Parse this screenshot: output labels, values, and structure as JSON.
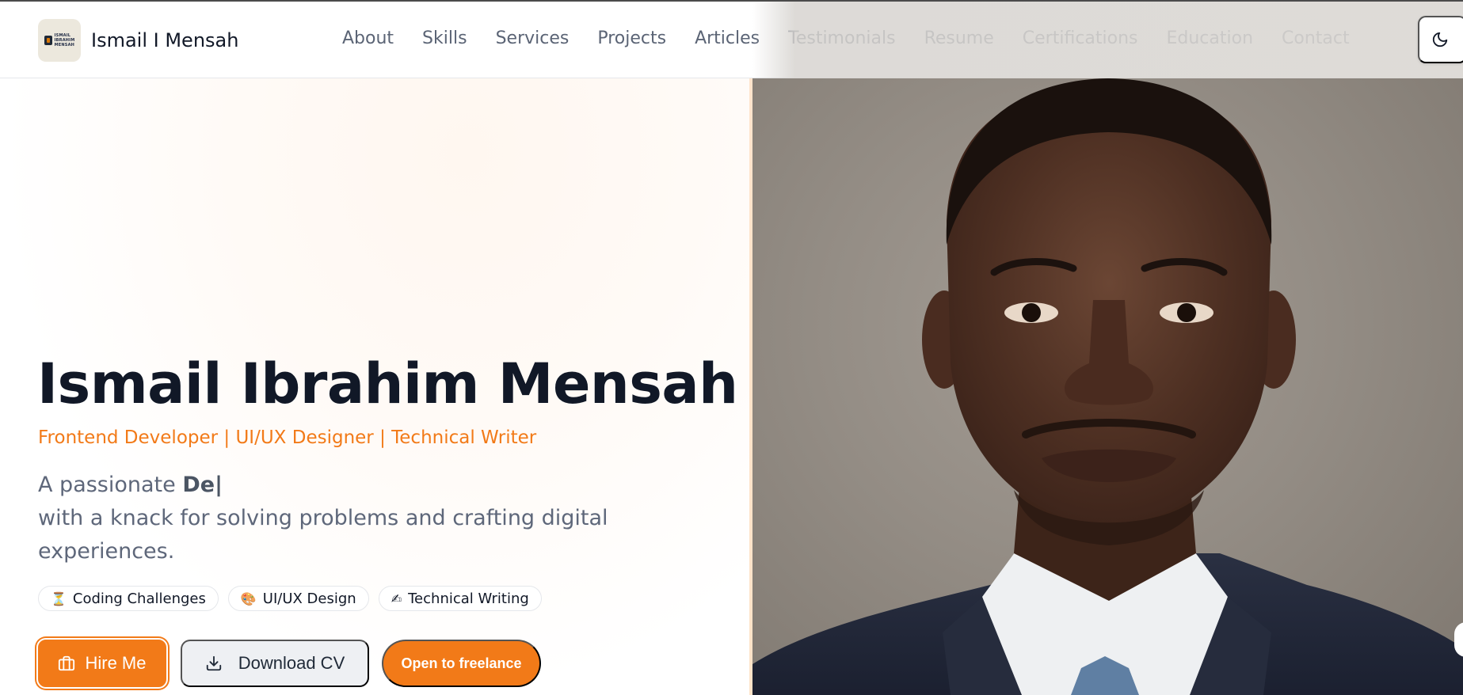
{
  "brand": {
    "logo_lines": [
      "ISMAIL",
      "IBRAHIM",
      "MENSAH"
    ],
    "name": "Ismail I Mensah"
  },
  "nav": {
    "items": [
      "About",
      "Skills",
      "Services",
      "Projects",
      "Articles",
      "Testimonials",
      "Resume",
      "Certifications",
      "Education",
      "Contact"
    ]
  },
  "theme_toggle": {
    "icon": "moon-icon"
  },
  "hero": {
    "name": "Ismail Ibrahim Mensah",
    "roles": "Frontend Developer | UI/UX Designer | Technical Writer",
    "desc_prefix": "A passionate",
    "typed_text": "De",
    "caret": "|",
    "desc_suffix": "with a knack for solving problems and crafting digital experiences.",
    "chips": [
      {
        "icon": "⏳",
        "label": "Coding Challenges"
      },
      {
        "icon": "🎨",
        "label": "UI/UX Design"
      },
      {
        "icon": "✍",
        "label": "Technical Writing"
      }
    ],
    "buttons": {
      "hire": "Hire Me",
      "download_cv": "Download CV",
      "freelance": "Open to freelance"
    }
  },
  "colors": {
    "accent": "#f27a18",
    "heading": "#111827",
    "muted_text": "#5e677a",
    "nav_text": "#5b6475"
  }
}
